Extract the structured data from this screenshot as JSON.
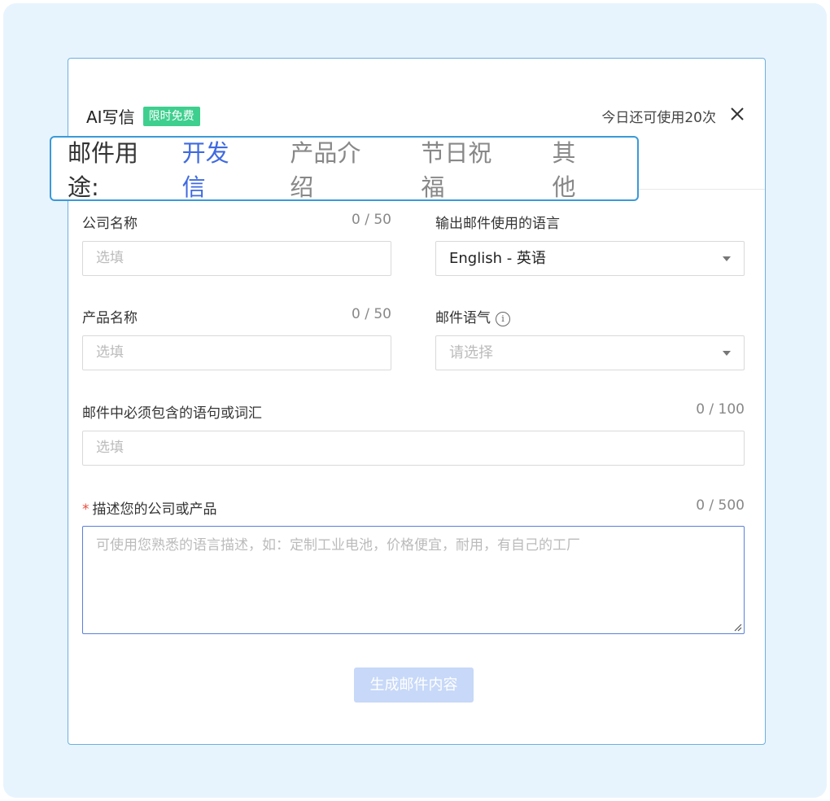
{
  "dialog": {
    "title": "AI写信",
    "badge": "限时免费",
    "quota": "今日还可使用20次"
  },
  "purpose": {
    "label": "邮件用途:",
    "tabs": [
      "开发信",
      "产品介绍",
      "节日祝福",
      "其他"
    ],
    "active_index": 0
  },
  "fields": {
    "company_name": {
      "label": "公司名称",
      "counter": "0 / 50",
      "placeholder": "选填"
    },
    "output_language": {
      "label": "输出邮件使用的语言",
      "value": "English - 英语"
    },
    "product_name": {
      "label": "产品名称",
      "counter": "0 / 50",
      "placeholder": "选填"
    },
    "tone": {
      "label": "邮件语气",
      "placeholder": "请选择",
      "info_icon": "i"
    },
    "must_include": {
      "label": "邮件中必须包含的语句或词汇",
      "counter": "0 / 100",
      "placeholder": "选填"
    },
    "description": {
      "required_mark": "*",
      "label": "描述您的公司或产品",
      "counter": "0 / 500",
      "placeholder": "可使用您熟悉的语言描述，如：定制工业电池，价格便宜，耐用，有自己的工厂"
    }
  },
  "generate_button": "生成邮件内容",
  "colors": {
    "accent": "#3f6ae0",
    "badge": "#3ecf8e",
    "button_disabled": "#c7d8f8",
    "highlight_border": "#3a9ad9"
  }
}
